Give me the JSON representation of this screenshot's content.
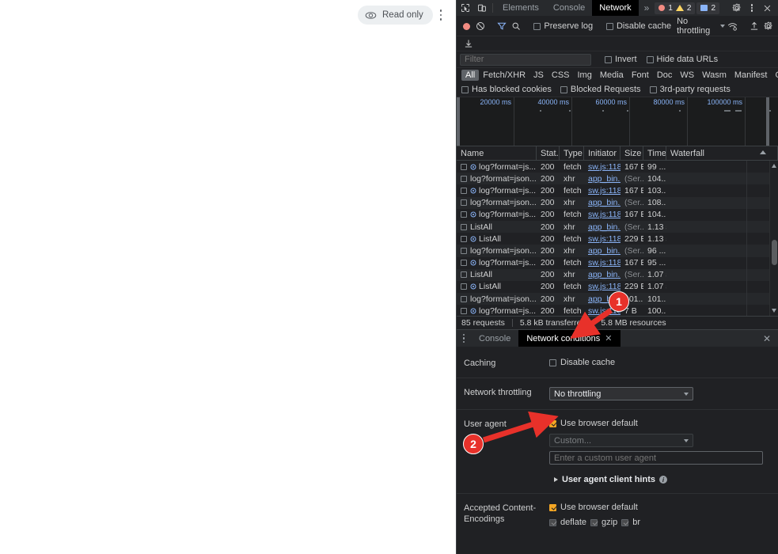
{
  "page": {
    "read_only_label": "Read only",
    "eye_icon": "eye-icon",
    "kebab_icon": "more-vertical-icon"
  },
  "devtools": {
    "tabbar": {
      "inspect_icon": "inspect-element-icon",
      "device_icon": "device-toolbar-icon",
      "tabs": [
        {
          "label": "Elements",
          "active": false
        },
        {
          "label": "Console",
          "active": false
        },
        {
          "label": "Network",
          "active": true
        }
      ],
      "more_tabs": "»",
      "errors": "1",
      "warnings": "2",
      "messages": "2",
      "settings_icon": "gear-icon",
      "kebab_icon": "more-vertical-icon",
      "close_icon": "close-icon"
    },
    "toolbar": {
      "record_icon": "record-stop-icon",
      "clear_icon": "clear-icon",
      "filter_icon": "filter-icon",
      "search_icon": "search-icon",
      "preserve_log": {
        "label": "Preserve log",
        "checked": false
      },
      "disable_cache": {
        "label": "Disable cache",
        "checked": false
      },
      "throttling": "No throttling",
      "wifi_icon": "network-conditions-icon",
      "import_icon": "import-har-icon",
      "export_icon": "export-har-icon",
      "settings_icon": "gear-icon"
    },
    "filter": {
      "placeholder": "Filter",
      "value": "",
      "invert": {
        "label": "Invert",
        "checked": false
      },
      "hide_data_urls": {
        "label": "Hide data URLs",
        "checked": false
      },
      "types": [
        "All",
        "Fetch/XHR",
        "JS",
        "CSS",
        "Img",
        "Media",
        "Font",
        "Doc",
        "WS",
        "Wasm",
        "Manifest",
        "Other"
      ],
      "active_type": "All",
      "has_blocked_cookies": {
        "label": "Has blocked cookies",
        "checked": false
      },
      "blocked_requests": {
        "label": "Blocked Requests",
        "checked": false
      },
      "third_party_requests": {
        "label": "3rd-party requests",
        "checked": false
      }
    },
    "overview": {
      "ticks": [
        "20000 ms",
        "40000 ms",
        "60000 ms",
        "80000 ms",
        "100000 ms"
      ]
    },
    "table": {
      "columns": [
        "Name",
        "Stat..",
        "Type",
        "Initiator",
        "Size",
        "Time",
        "Waterfall"
      ],
      "rows": [
        {
          "name": "log?format=js...",
          "gear": true,
          "status": "200",
          "type": "fetch",
          "initiator": "sw.js:118",
          "size": "167 B",
          "time": "99 ...",
          "wf": 92
        },
        {
          "name": "log?format=json...",
          "gear": false,
          "status": "200",
          "type": "xhr",
          "initiator": "app_bin...",
          "size": "(Ser...",
          "time": "104...",
          "wf": 93
        },
        {
          "name": "log?format=js...",
          "gear": true,
          "status": "200",
          "type": "fetch",
          "initiator": "sw.js:118",
          "size": "167 B",
          "time": "103...",
          "wf": 94
        },
        {
          "name": "log?format=json...",
          "gear": false,
          "status": "200",
          "type": "xhr",
          "initiator": "app_bin...",
          "size": "(Ser...",
          "time": "108...",
          "wf": 94
        },
        {
          "name": "log?format=js...",
          "gear": true,
          "status": "200",
          "type": "fetch",
          "initiator": "sw.js:118",
          "size": "167 B",
          "time": "104...",
          "wf": 96
        },
        {
          "name": "ListAll",
          "gear": false,
          "status": "200",
          "type": "xhr",
          "initiator": "app_bin...",
          "size": "(Ser...",
          "time": "1.13 s",
          "wf": 96
        },
        {
          "name": "ListAll",
          "gear": true,
          "status": "200",
          "type": "fetch",
          "initiator": "sw.js:118",
          "size": "229 B",
          "time": "1.13 s",
          "wf": 96
        },
        {
          "name": "log?format=json...",
          "gear": false,
          "status": "200",
          "type": "xhr",
          "initiator": "app_bin...",
          "size": "(Ser...",
          "time": "96 ...",
          "wf": 97
        },
        {
          "name": "log?format=js...",
          "gear": true,
          "status": "200",
          "type": "fetch",
          "initiator": "sw.js:118",
          "size": "167 B",
          "time": "95 ...",
          "wf": 97
        },
        {
          "name": "ListAll",
          "gear": false,
          "status": "200",
          "type": "xhr",
          "initiator": "app_bin...",
          "size": "(Ser...",
          "time": "1.07 s",
          "wf": 97
        },
        {
          "name": "ListAll",
          "gear": true,
          "status": "200",
          "type": "fetch",
          "initiator": "sw.js:118",
          "size": "229 B",
          "time": "1.07 s",
          "wf": 97
        },
        {
          "name": "log?format=json...",
          "gear": false,
          "status": "200",
          "type": "xhr",
          "initiator": "app_bin...",
          "size": "101...",
          "time": "101...",
          "wf": 98
        },
        {
          "name": "log?format=js...",
          "gear": true,
          "status": "200",
          "type": "fetch",
          "initiator": "sw.js:118",
          "size": "7 B",
          "time": "100...",
          "wf": 98
        }
      ]
    },
    "summary": {
      "requests": "85 requests",
      "transferred": "5.8 kB transferred",
      "resources": "5.8 MB resources"
    },
    "drawer": {
      "kebab_icon": "more-vertical-icon",
      "tabs": [
        {
          "label": "Console",
          "active": false,
          "closable": false
        },
        {
          "label": "Network conditions",
          "active": true,
          "closable": true
        }
      ],
      "close_icon": "close-icon"
    },
    "network_conditions": {
      "caching": {
        "label": "Caching",
        "disable_cache": {
          "label": "Disable cache",
          "checked": false
        }
      },
      "throttling": {
        "label": "Network throttling",
        "value": "No throttling"
      },
      "user_agent": {
        "label": "User agent",
        "use_browser_default": {
          "label": "Use browser default",
          "checked": true
        },
        "select_value": "Custom...",
        "input_placeholder": "Enter a custom user agent",
        "input_value": "",
        "client_hints_label": "User agent client hints",
        "info_icon": "info-icon"
      },
      "encodings": {
        "label": "Accepted Content-Encodings",
        "use_browser_default": {
          "label": "Use browser default",
          "checked": true
        },
        "options": [
          {
            "label": "deflate",
            "checked": true
          },
          {
            "label": "gzip",
            "checked": true
          },
          {
            "label": "br",
            "checked": true
          }
        ]
      }
    }
  },
  "annotations": [
    {
      "number": "1"
    },
    {
      "number": "2"
    }
  ],
  "colors": {
    "accent_blue": "#8ab4f8",
    "annotation_red": "#e8312a",
    "checkbox_orange": "#f5a623",
    "panel_bg": "#202124",
    "tabbar_bg": "#282a2d"
  }
}
